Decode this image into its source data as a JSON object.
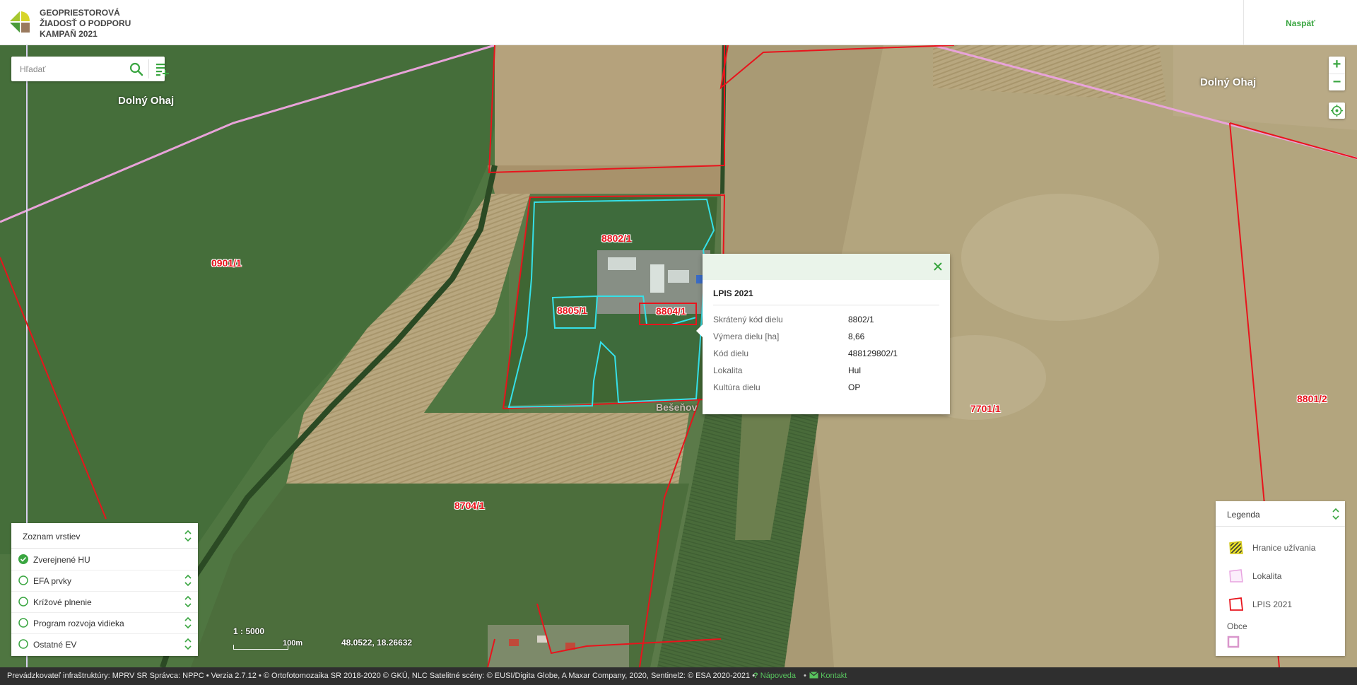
{
  "header": {
    "brand_line1": "GEOPRIESTOROVÁ",
    "brand_line2": "ŽIADOSŤ O PODPORU",
    "brand_line3": "KAMPAŇ 2021",
    "back_label": "Naspäť"
  },
  "search": {
    "placeholder": "Hľadať"
  },
  "map": {
    "place_labels": [
      "Dolný Ohaj",
      "Dolný Ohaj",
      "Bešeňov"
    ],
    "parcel_labels": [
      "0901/1",
      "8802/1",
      "8805/1",
      "8804/1",
      "8704/1",
      "7701/1",
      "8801/2"
    ],
    "scale": "1 : 5000",
    "scale_unit": "100m",
    "coordinates": "48.0522, 18.26632"
  },
  "popup": {
    "title": "LPIS 2021",
    "rows": [
      {
        "key": "Skrátený kód dielu",
        "value": "8802/1"
      },
      {
        "key": "Výmera dielu [ha]",
        "value": "8,66"
      },
      {
        "key": "Kód dielu",
        "value": "488129802/1"
      },
      {
        "key": "Lokalita",
        "value": "Hul"
      },
      {
        "key": "Kultúra dielu",
        "value": "OP"
      }
    ]
  },
  "layers": {
    "title": "Zoznam vrstiev",
    "items": [
      {
        "label": "Zverejnené HU",
        "checked": true
      },
      {
        "label": "EFA prvky",
        "checked": false
      },
      {
        "label": "Krížové plnenie",
        "checked": false
      },
      {
        "label": "Program rozvoja vidieka",
        "checked": false
      },
      {
        "label": "Ostatné EV",
        "checked": false
      }
    ]
  },
  "legend": {
    "title": "Legenda",
    "items": [
      {
        "label": "Hranice užívania",
        "icon": "hatched-yellow-polygon-icon"
      },
      {
        "label": "Lokalita",
        "icon": "pink-outline-polygon-icon"
      },
      {
        "label": "LPIS 2021",
        "icon": "red-outline-polygon-icon"
      }
    ],
    "sub_title": "Obce",
    "sub_icon": "pink-square-icon"
  },
  "footer": {
    "text": "Prevádzkovateľ infraštruktúry: MPRV SR Správca: NPPC • Verzia 2.7.12 • © Ortofotomozaika SR 2018-2020 © GKÚ, NLC Satelitné scény: © EUSI/Digita Globe, A Maxar Company, 2020, Sentinel2: © ESA 2020-2021 •",
    "help": "Nápoveda",
    "contact": "Kontakt"
  },
  "colors": {
    "accent": "#3aa641",
    "lpis_boundary": "#e8141c",
    "selected_parcel": "#35e0e8",
    "municipality_line": "#e8a3d9"
  }
}
